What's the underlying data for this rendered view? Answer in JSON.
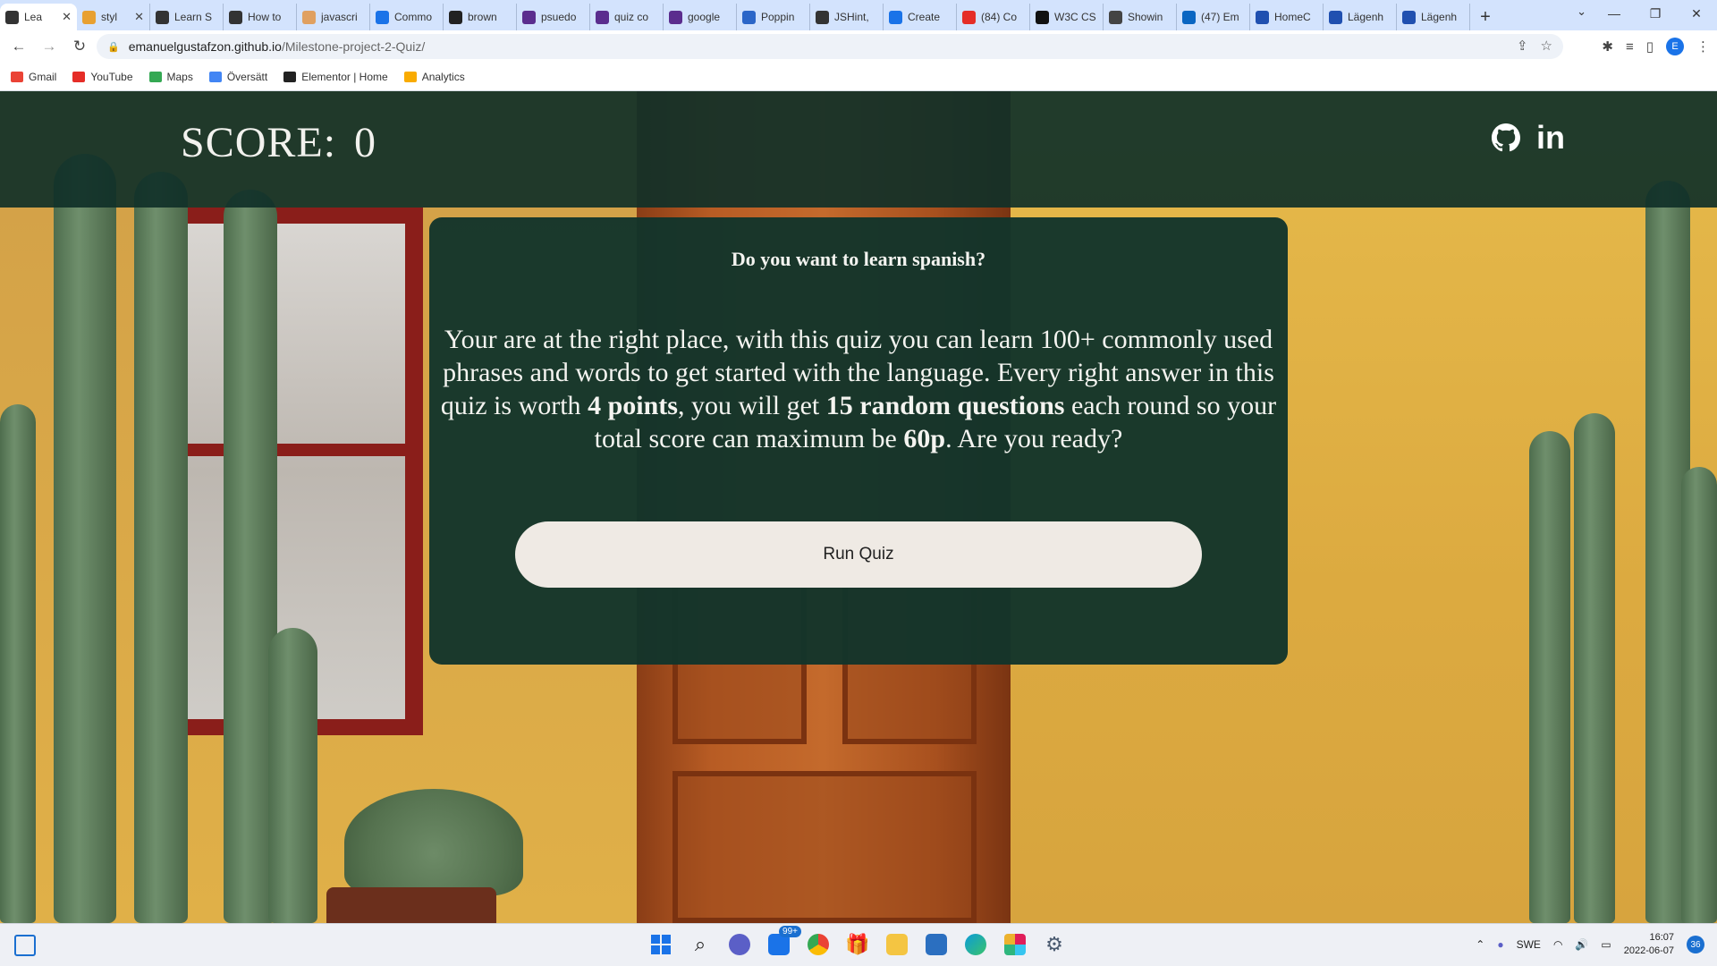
{
  "browser": {
    "tabs": [
      {
        "title": "Lea",
        "color": "#333333",
        "active": true
      },
      {
        "title": "styl",
        "color": "#e8a030"
      },
      {
        "title": "Learn S",
        "color": "#333333"
      },
      {
        "title": "How to",
        "color": "#333333"
      },
      {
        "title": "javascri",
        "color": "#e0a060"
      },
      {
        "title": "Commo",
        "color": "#1a73e8"
      },
      {
        "title": "brown",
        "color": "#222222"
      },
      {
        "title": "psuedo",
        "color": "#5b2d8e"
      },
      {
        "title": "quiz co",
        "color": "#5b2d8e"
      },
      {
        "title": "google",
        "color": "#5b2d8e"
      },
      {
        "title": "Poppin",
        "color": "#2b66c8"
      },
      {
        "title": "JSHint,",
        "color": "#333333"
      },
      {
        "title": "Create",
        "color": "#1a73e8"
      },
      {
        "title": "(84) Co",
        "color": "#e52d27"
      },
      {
        "title": "W3C CS",
        "color": "#111111"
      },
      {
        "title": "Showin",
        "color": "#444444"
      },
      {
        "title": "(47) Em",
        "color": "#0a66c2"
      },
      {
        "title": "HomeC",
        "color": "#2050b0"
      },
      {
        "title": "Lägenh",
        "color": "#2050b0"
      },
      {
        "title": "Lägenh",
        "color": "#2050b0"
      }
    ],
    "url_host": "emanuelgustafzon.github.io",
    "url_path": "/Milestone-project-2-Quiz/",
    "profile_initial": "E",
    "bookmarks": [
      {
        "label": "Gmail",
        "color": "#ea4335"
      },
      {
        "label": "YouTube",
        "color": "#e52d27"
      },
      {
        "label": "Maps",
        "color": "#34a853"
      },
      {
        "label": "Översätt",
        "color": "#4285f4"
      },
      {
        "label": "Elementor | Home",
        "color": "#222222"
      },
      {
        "label": "Analytics",
        "color": "#f9ab00"
      }
    ]
  },
  "page": {
    "score_label": "SCORE:",
    "score_value": "0",
    "heading": "Do you want to learn spanish?",
    "intro": {
      "part1": "Your are at the right place, with this quiz you can learn 100+ commonly used phrases and words to get started with the language. Every right answer in this quiz is worth ",
      "bold1": "4 points",
      "part2": ", you will get ",
      "bold2": "15 random questions",
      "part3": " each round so your total score can maximum be ",
      "bold3": "60p",
      "part4": ". Are you ready?"
    },
    "run_button": "Run Quiz",
    "colors": {
      "header_bg": "#103028",
      "card_bg": "#12342b",
      "button_bg": "#efeae4"
    }
  },
  "taskbar": {
    "mail_badge": "99+",
    "language": "SWE",
    "time": "16:07",
    "date": "2022-06-07",
    "notifications": "36"
  }
}
